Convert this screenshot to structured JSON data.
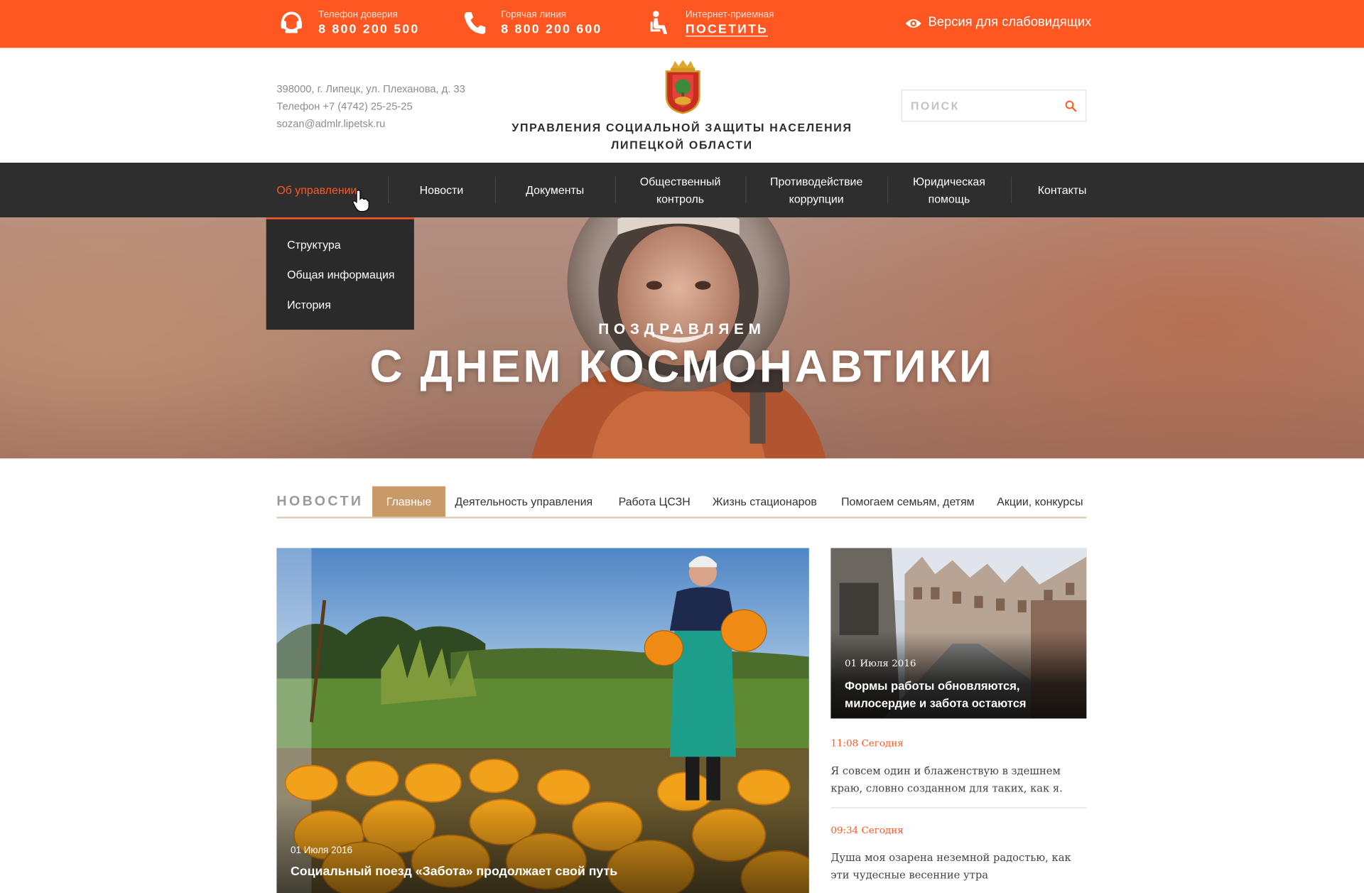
{
  "topbar": {
    "trust": {
      "label": "Телефон доверия",
      "value": "8 800 200 500"
    },
    "hotline": {
      "label": "Горячая линия",
      "value": "8 800 200 600"
    },
    "reception": {
      "label": "Интернет-приемная",
      "value": "ПОСЕТИТЬ"
    },
    "vision": "Версия для слабовидящих",
    "accent_color": "#ff5722"
  },
  "header": {
    "address": "398000, г. Липецк, ул. Плеханова, д. 33",
    "phone": "Телефон +7 (4742) 25-25-25",
    "email": "sozan@admlr.lipetsk.ru",
    "title_line1": "УПРАВЛЕНИЯ СОЦИАЛЬНОЙ ЗАЩИТЫ НАСЕЛЕНИЯ",
    "title_line2": "ЛИПЕЦКОЙ ОБЛАСТИ",
    "search_placeholder": "ПОИСК"
  },
  "nav": {
    "items": [
      {
        "label": "Об управлении",
        "active": true
      },
      {
        "label": "Новости"
      },
      {
        "label": "Документы"
      },
      {
        "label_line1": "Общественный",
        "label_line2": "контроль"
      },
      {
        "label_line1": "Противодействие",
        "label_line2": "коррупции"
      },
      {
        "label_line1": "Юридическая",
        "label_line2": "помощь"
      },
      {
        "label": "Контакты"
      }
    ],
    "dropdown": [
      "Структура",
      "Общая информация",
      "История"
    ]
  },
  "hero": {
    "subtitle": "ПОЗДРАВЛЯЕМ",
    "title": "С ДНЕМ КОСМОНАВТИКИ"
  },
  "news": {
    "heading": "НОВОСТИ",
    "tabs": [
      "Главные",
      "Деятельность управления",
      "Работа ЦСЗН",
      "Жизнь стационаров",
      "Помогаем семьям, детям",
      "Акции, конкурсы"
    ],
    "main": {
      "date": "01 Июля 2016",
      "title": "Социальный поезд «Забота» продолжает свой путь"
    },
    "side": {
      "date": "01 Июля 2016",
      "title": "Формы работы обновляются, милосердие и забота остаются"
    },
    "list": [
      {
        "time": "11:08 Сегодня",
        "text": "Я совсем один и блаженствую в здешнем краю, словно созданном для таких, как я."
      },
      {
        "time": "09:34 Сегодня",
        "text": "Душа моя озарена неземной радостью, как эти чудесные весенние утра"
      }
    ]
  }
}
